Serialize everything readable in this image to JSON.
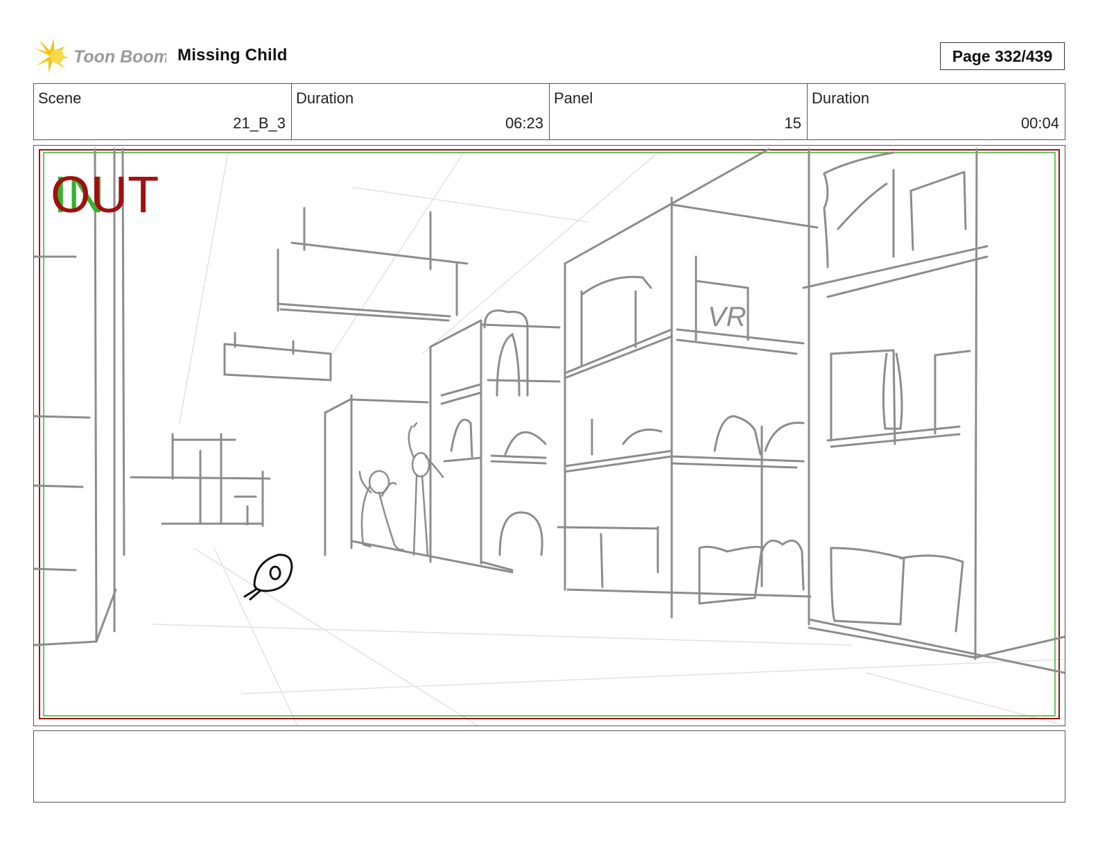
{
  "header": {
    "logo_text": "Toon Boom",
    "project_title": "Missing Child",
    "page_label": "Page 332/439"
  },
  "info": {
    "scene_label": "Scene",
    "scene_value": "21_B_3",
    "scene_duration_label": "Duration",
    "scene_duration_value": "06:23",
    "panel_label": "Panel",
    "panel_value": "15",
    "panel_duration_label": "Duration",
    "panel_duration_value": "00:04"
  },
  "panel": {
    "in_marker": "IN",
    "out_marker": "OUT",
    "sign_text": "VR"
  },
  "colors": {
    "in_green": "#2fb52f",
    "out_red": "#a01010",
    "sketch_gray": "#8c8c8c",
    "logo_yellow": "#f5c400"
  }
}
